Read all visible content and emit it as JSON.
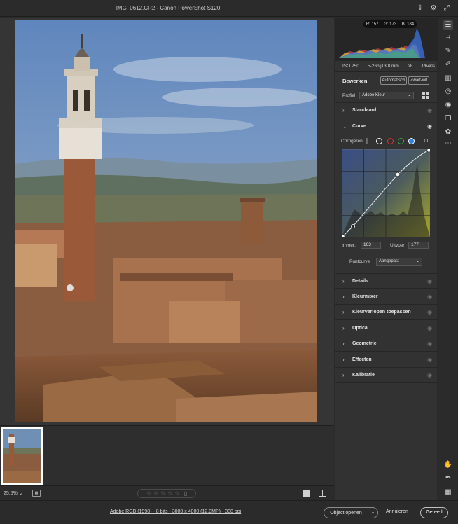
{
  "window": {
    "title": "IMG_0612.CR2  -  Canon PowerShot S120"
  },
  "titlebar_icons": [
    "export-icon",
    "gear-icon",
    "expand-icon"
  ],
  "histogram": {
    "readout": {
      "r": "R: 157",
      "g": "G: 173",
      "b": "B: 184"
    }
  },
  "exif": {
    "iso": "ISO 250",
    "focal": "5-26bij13,8 mm",
    "aperture": "f/8",
    "shutter": "1/640s"
  },
  "edit": {
    "heading": "Bewerken",
    "auto_label": "Automatisch",
    "bw_label": "Zwart-wit"
  },
  "profile": {
    "label": "Profiel",
    "value": "Adobe Kleur"
  },
  "sections_top": [
    {
      "name": "Standaard",
      "expanded": false
    }
  ],
  "curve": {
    "name": "Curve",
    "expanded": true,
    "adjust_label": "Corrigeren",
    "channels": [
      "point",
      "white",
      "red",
      "green",
      "blue"
    ],
    "active_channel": "blue",
    "input_label": "Invoer:",
    "input_value": "163",
    "output_label": "Uitvoer:",
    "output_value": "177",
    "pointcurve_label": "Puntcurve",
    "pointcurve_value": "Aangepast"
  },
  "sections_bottom": [
    {
      "name": "Details"
    },
    {
      "name": "Kleurmixer"
    },
    {
      "name": "Kleurverlopen toepassen"
    },
    {
      "name": "Optica"
    },
    {
      "name": "Geometrie"
    },
    {
      "name": "Effecten"
    },
    {
      "name": "Kalibratie"
    }
  ],
  "canvas_bar": {
    "zoom": "25,5%",
    "rating_stars": 5
  },
  "footer": {
    "info": "Adobe RGB (1998) - 8 bits - 3000 x 4000 (12,0MP) - 300 ppi",
    "open_label": "Object openen",
    "cancel_label": "Annuleren",
    "done_label": "Gereed"
  },
  "tools": [
    "sliders-icon",
    "crop-icon",
    "healing-icon",
    "brush-icon",
    "gradient-icon",
    "radial-icon",
    "redeye-icon",
    "snapshots-icon",
    "presets-icon",
    "more-icon",
    "hand-icon",
    "eyedropper-icon",
    "grid-icon"
  ]
}
